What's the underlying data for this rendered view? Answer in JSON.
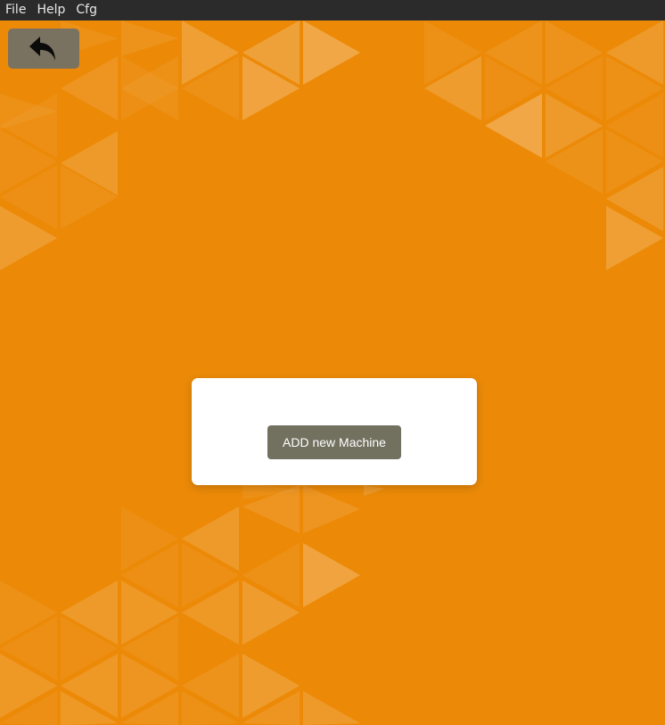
{
  "menubar": {
    "items": [
      {
        "label": "File"
      },
      {
        "label": "Help"
      },
      {
        "label": "Cfg"
      }
    ]
  },
  "toolbar": {
    "back_icon": "undo-arrow-icon"
  },
  "card": {
    "add_button_label": "ADD new Machine"
  },
  "colors": {
    "background": "#ec8a08",
    "menubar": "#2b2b2b",
    "button": "#72705f",
    "back_button": "#7a7260",
    "card": "#ffffff"
  }
}
